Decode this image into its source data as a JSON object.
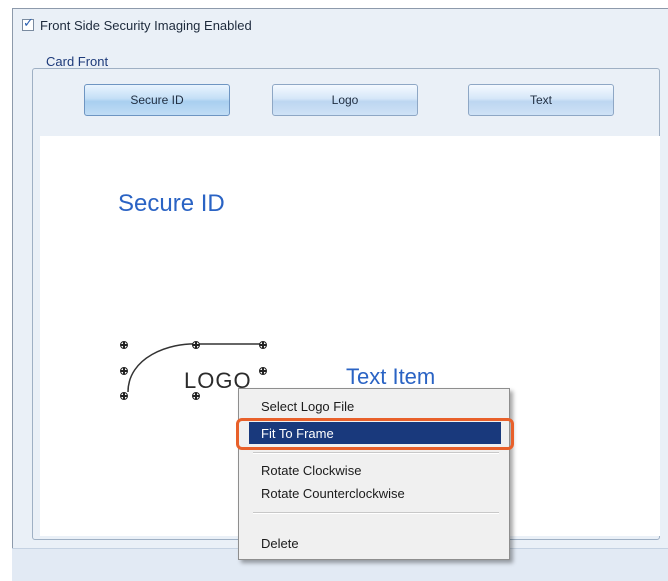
{
  "settings": {
    "checkbox_label": "Front Side Security Imaging Enabled",
    "checkbox_checked": true,
    "group_label": "Card Front"
  },
  "tabs": [
    {
      "label": "Secure ID",
      "active": true
    },
    {
      "label": "Logo",
      "active": false
    },
    {
      "label": "Text",
      "active": false
    }
  ],
  "canvas": {
    "title": "Secure ID",
    "logo_text": "LOGO",
    "text_item": "Text Item"
  },
  "context_menu": {
    "items": [
      {
        "label": "Select Logo File",
        "highlighted": false
      },
      {
        "label": "Fit To Frame",
        "highlighted": true
      },
      {
        "label": "Rotate Clockwise",
        "highlighted": false
      },
      {
        "label": "Rotate Counterclockwise",
        "highlighted": false
      },
      {
        "label": "Delete",
        "highlighted": false
      }
    ]
  },
  "colors": {
    "accent_blue": "#2a63c4",
    "menu_highlight": "#19397c",
    "callout_orange": "#e8602a"
  }
}
